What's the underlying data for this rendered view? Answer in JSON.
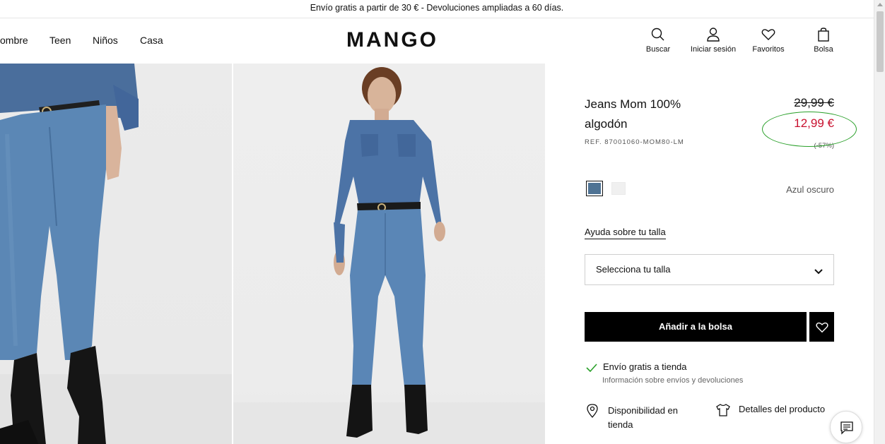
{
  "promo": {
    "text": "Envío gratis a partir de 30 € - Devoluciones ampliadas a 60 días."
  },
  "header": {
    "nav": [
      "ombre",
      "Teen",
      "Niños",
      "Casa"
    ],
    "logo": "MANGO",
    "actions": {
      "search": "Buscar",
      "login": "Iniciar sesión",
      "favorites": "Favoritos",
      "bag": "Bolsa"
    }
  },
  "product": {
    "title": "Jeans Mom 100% algodón",
    "ref": "REF. 87001060-MOM80-LM",
    "price_old": "29,99 €",
    "price_new": "12,99 €",
    "discount": "(-57%)",
    "color_name": "Azul oscuro",
    "colors": {
      "selected": "#4f7394",
      "other": "#f0f0f0"
    }
  },
  "size": {
    "help_label": "Ayuda sobre tu talla",
    "select_placeholder": "Selecciona tu talla"
  },
  "actions": {
    "add_to_bag": "Añadir a la bolsa"
  },
  "shipping": {
    "title": "Envío gratis a tienda",
    "info": "Información sobre envíos y devoluciones"
  },
  "links": {
    "store_availability": "Disponibilidad en tienda",
    "product_details": "Detalles del producto"
  },
  "colors": {
    "price_sale": "#c8102e",
    "annotation": "#2aa02a",
    "button": "#000000"
  }
}
